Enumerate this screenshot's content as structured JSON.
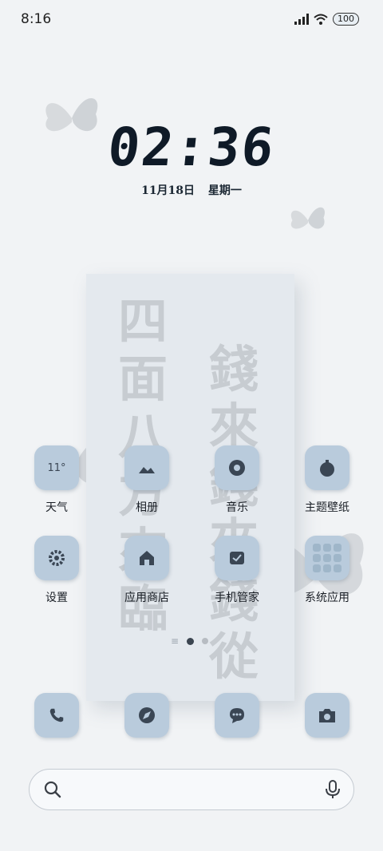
{
  "status_bar": {
    "time": "8:16",
    "battery": "100"
  },
  "clock": {
    "time": "02:36",
    "date": "11月18日",
    "weekday": "星期一"
  },
  "wallpaper": {
    "text_left": "四面八方來臨",
    "text_right": "錢來錢來錢從"
  },
  "apps": [
    {
      "label": "天气",
      "icon": "weather-icon",
      "icon_text": "11°"
    },
    {
      "label": "相册",
      "icon": "gallery-icon"
    },
    {
      "label": "音乐",
      "icon": "music-icon"
    },
    {
      "label": "主题壁纸",
      "icon": "themes-icon"
    },
    {
      "label": "设置",
      "icon": "settings-gear-icon"
    },
    {
      "label": "应用商店",
      "icon": "app-store-icon"
    },
    {
      "label": "手机管家",
      "icon": "security-icon"
    },
    {
      "label": "系统应用",
      "icon": "folder-icon"
    }
  ],
  "dock": [
    {
      "icon": "phone-icon"
    },
    {
      "icon": "browser-icon"
    },
    {
      "icon": "messages-icon"
    },
    {
      "icon": "camera-icon"
    }
  ],
  "colors": {
    "icon_bg": "#b9cbdc",
    "background": "#f1f3f5",
    "clock": "#0f1a27"
  }
}
